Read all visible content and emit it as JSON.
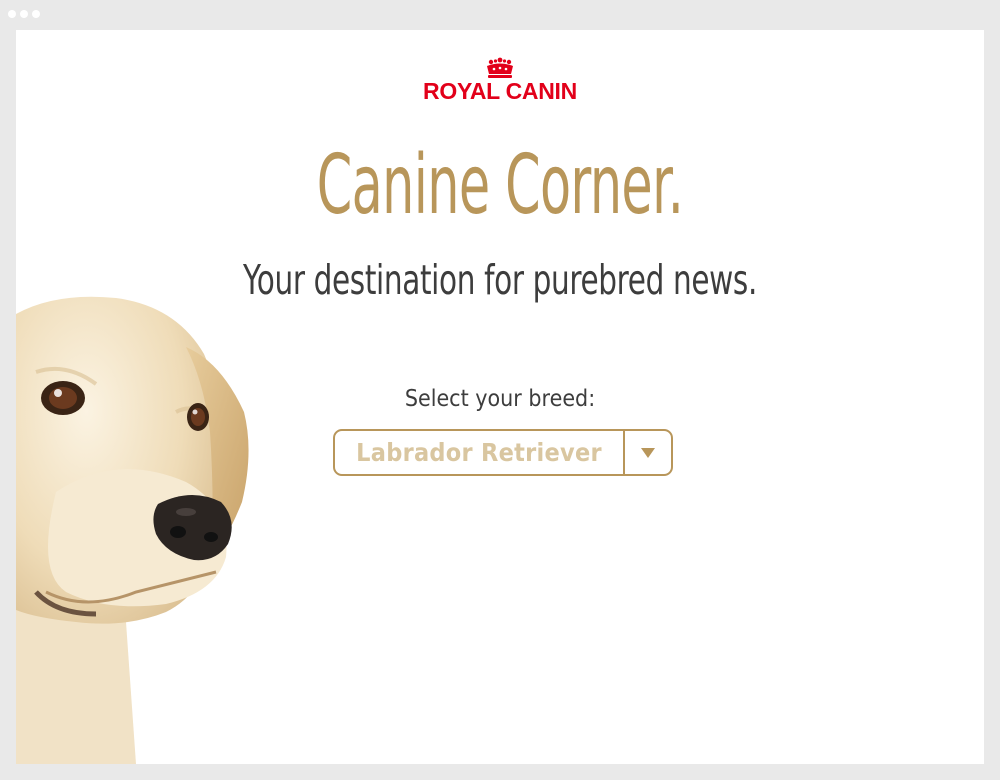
{
  "brand": {
    "logo_text": "ROYAL CANIN",
    "logo_icon": "crown-icon",
    "logo_color": "#e2001a"
  },
  "colors": {
    "accent_gold": "#b8965a",
    "text_dark": "#3d3d3d",
    "placeholder_gold": "#d9c6a0"
  },
  "hero": {
    "title": "Canine Corner.",
    "subtitle": "Your destination for purebred news."
  },
  "breed_selector": {
    "label": "Select your breed:",
    "selected_value": "Labrador Retriever",
    "arrow_icon": "caret-down-icon"
  },
  "image": {
    "subject": "labrador-dog-image"
  }
}
